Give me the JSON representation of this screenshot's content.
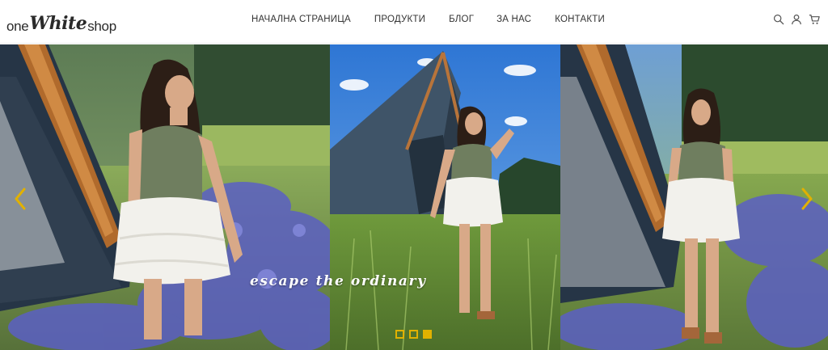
{
  "brand": {
    "logo_prefix": "one",
    "logo_bold": "White",
    "logo_suffix": "shop"
  },
  "nav": {
    "items": [
      {
        "label": "НАЧАЛНА СТРАНИЦА"
      },
      {
        "label": "ПРОДУКТИ"
      },
      {
        "label": "БЛОГ"
      },
      {
        "label": "ЗА НАС"
      },
      {
        "label": "КОНТАКТИ"
      }
    ]
  },
  "header_icons": [
    "search-icon",
    "user-icon",
    "cart-icon"
  ],
  "hero": {
    "tagline": "escape the ordinary",
    "slides_count": 3,
    "active_slide": 3,
    "arrow_color": "#e1b100",
    "dot_color": "#e1b100"
  }
}
